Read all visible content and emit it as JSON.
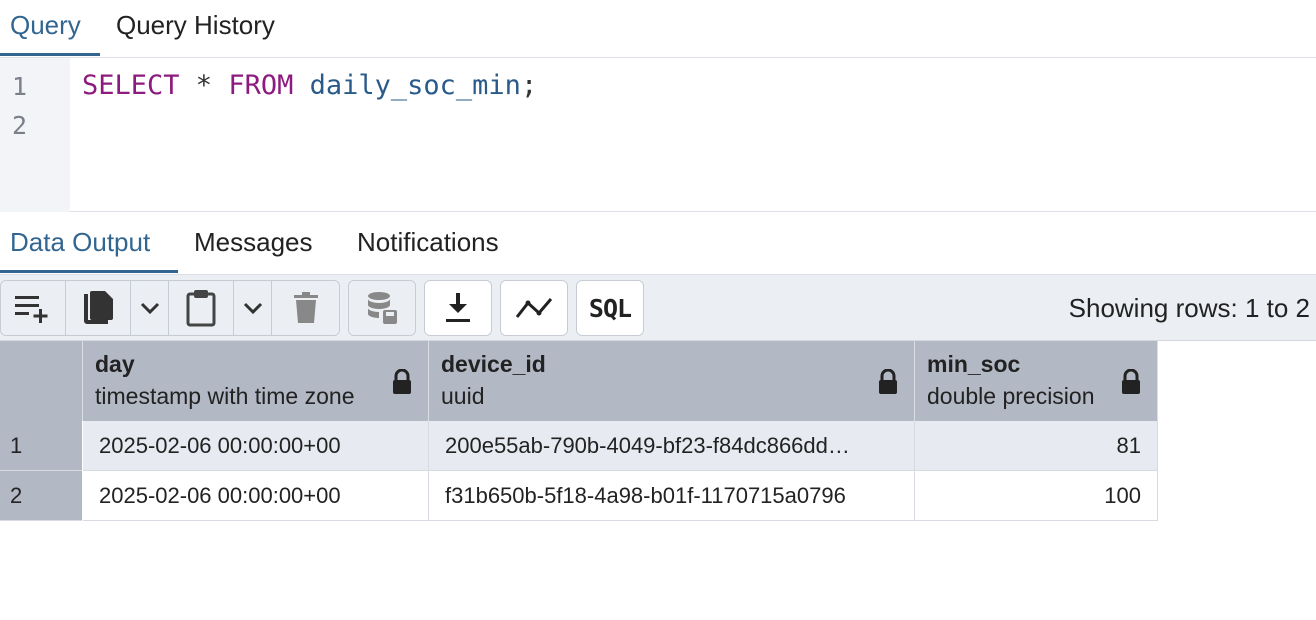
{
  "top_tabs": [
    "Query",
    "Query History"
  ],
  "editor": {
    "lines": [
      {
        "number": "1",
        "tokens": [
          {
            "text": "SELECT",
            "kind": "kw"
          },
          {
            "text": " * ",
            "kind": "op"
          },
          {
            "text": "FROM",
            "kind": "kw"
          },
          {
            "text": " daily_soc_min",
            "kind": "ident"
          },
          {
            "text": ";",
            "kind": "punct"
          }
        ]
      },
      {
        "number": "2",
        "tokens": []
      }
    ]
  },
  "output_tabs": [
    "Data Output",
    "Messages",
    "Notifications"
  ],
  "toolbar": {
    "icons": [
      "add-row-icon",
      "copy-icon",
      "chevron-down-icon",
      "paste-icon",
      "chevron-down-icon",
      "delete-icon",
      "save-data-icon",
      "download-icon",
      "graph-visualiser-icon",
      "sql-icon"
    ],
    "sql_label": "SQL",
    "status": "Showing rows: 1 to 2"
  },
  "table": {
    "columns": [
      {
        "name": "day",
        "type": "timestamp with time zone",
        "locked": true
      },
      {
        "name": "device_id",
        "type": "uuid",
        "locked": true
      },
      {
        "name": "min_soc",
        "type": "double precision",
        "locked": true
      }
    ],
    "rows": [
      {
        "num": "1",
        "cells": [
          "2025-02-06 00:00:00+00",
          "200e55ab-790b-4049-bf23-f84dc866dd…",
          "81"
        ]
      },
      {
        "num": "2",
        "cells": [
          "2025-02-06 00:00:00+00",
          "f31b650b-5f18-4a98-b01f-1170715a0796",
          "100"
        ]
      }
    ]
  },
  "colors": {
    "accent": "#326690",
    "keyword": "#8d1a7e",
    "identifier": "#2a5a8a",
    "header_bg": "#b2b8c4",
    "toolbar_bg": "#ebeef3",
    "alt_row_bg": "#e7eaf1"
  }
}
